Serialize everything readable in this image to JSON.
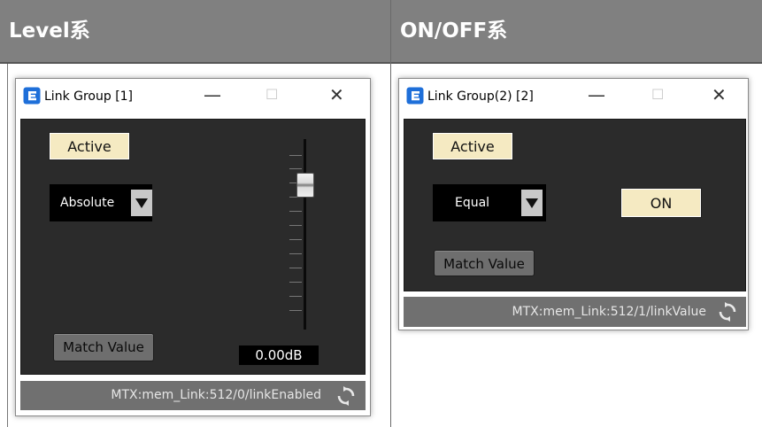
{
  "headers": {
    "left": "Level系",
    "right": "ON/OFF系"
  },
  "level_window": {
    "title": "Link Group [1]",
    "controls": {
      "minimize": "—",
      "maximize": "☐",
      "close": "✕"
    },
    "active_label": "Active",
    "mode_select": {
      "value": "Absolute"
    },
    "match_value_label": "Match Value",
    "fader_value": "0.00dB",
    "status_text": "MTX:mem_Link:512/0/linkEnabled"
  },
  "onoff_window": {
    "title": "Link Group(2) [2]",
    "controls": {
      "minimize": "—",
      "maximize": "☐",
      "close": "✕"
    },
    "active_label": "Active",
    "mode_select": {
      "value": "Equal"
    },
    "on_label": "ON",
    "match_value_label": "Match Value",
    "status_text": "MTX:mem_Link:512/1/linkValue"
  },
  "colors": {
    "header_bg": "#808080",
    "panel_bg": "#2b2b2b",
    "active_button": "#f5eac2",
    "status_bar": "#707070",
    "app_icon_blue": "#1e6fd9"
  },
  "icons": {
    "app": "app-icon",
    "sync": "sync-icon",
    "dropdown": "chevron-down-icon"
  }
}
